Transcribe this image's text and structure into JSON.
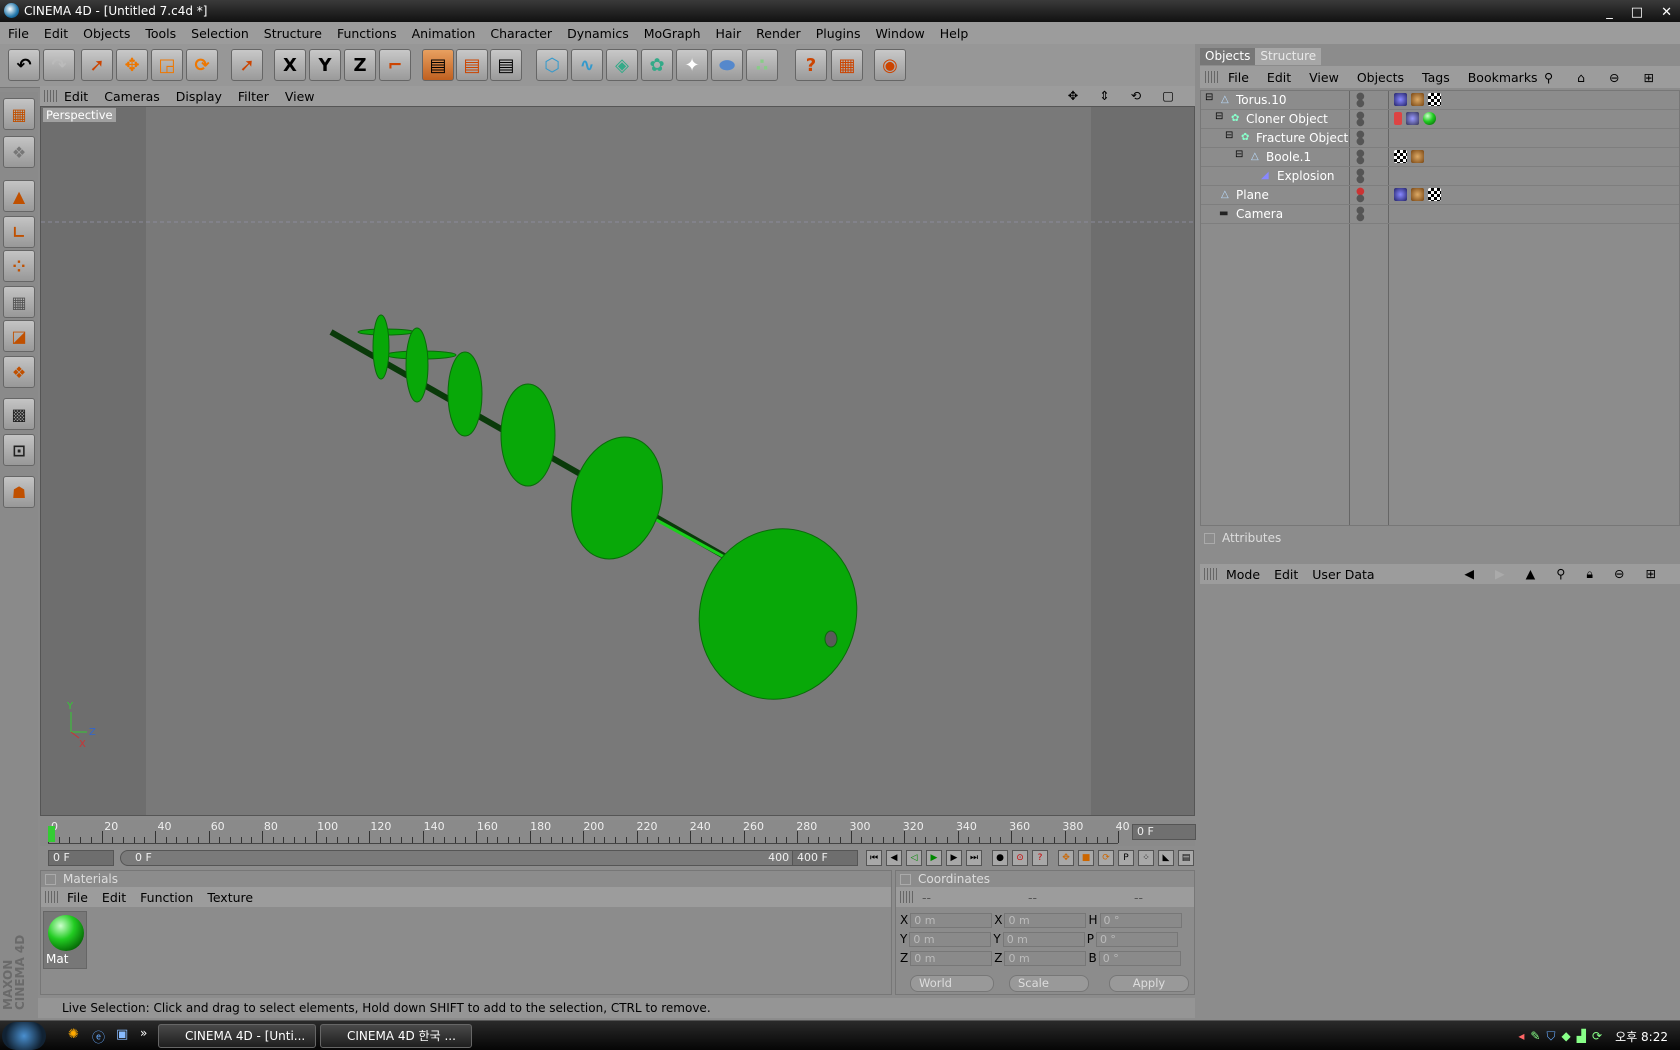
{
  "window": {
    "title": "CINEMA 4D - [Untitled 7.c4d *]",
    "controls": [
      "_",
      "□",
      "✕"
    ]
  },
  "menu": [
    "File",
    "Edit",
    "Objects",
    "Tools",
    "Selection",
    "Structure",
    "Functions",
    "Animation",
    "Character",
    "Dynamics",
    "MoGraph",
    "Hair",
    "Render",
    "Plugins",
    "Window",
    "Help"
  ],
  "toolbar": {
    "axis_x": "X",
    "axis_y": "Y",
    "axis_z": "Z"
  },
  "viewport": {
    "menu": [
      "Edit",
      "Cameras",
      "Display",
      "Filter",
      "View"
    ],
    "label": "Perspective",
    "axis": {
      "y": "Y",
      "x": "X",
      "z": "Z"
    },
    "model_color": "#08a808"
  },
  "timeline": {
    "ticks": [
      "0",
      "20",
      "40",
      "60",
      "80",
      "100",
      "120",
      "140",
      "160",
      "180",
      "200",
      "220",
      "240",
      "260",
      "280",
      "300",
      "320",
      "340",
      "360",
      "380",
      "40"
    ],
    "current_frame": "0 F",
    "start_field": "0 F",
    "range_start": "0 F",
    "range_end": "400 F",
    "end_field": "400 F"
  },
  "materials": {
    "title": "Materials",
    "menu": [
      "File",
      "Edit",
      "Function",
      "Texture"
    ],
    "items": [
      {
        "name": "Mat",
        "color": "#1fbf1f"
      }
    ]
  },
  "coordinates": {
    "title": "Coordinates",
    "headers": [
      "--",
      "--",
      "--"
    ],
    "rows": [
      {
        "a": "X",
        "av": "0 m",
        "b": "X",
        "bv": "0 m",
        "c": "H",
        "cv": "0 °"
      },
      {
        "a": "Y",
        "av": "0 m",
        "b": "Y",
        "bv": "0 m",
        "c": "P",
        "cv": "0 °"
      },
      {
        "a": "Z",
        "av": "0 m",
        "b": "Z",
        "bv": "0 m",
        "c": "B",
        "cv": "0 °"
      }
    ],
    "mode": "World",
    "scale": "Scale",
    "apply": "Apply"
  },
  "status": "Live Selection: Click and drag to select elements, Hold down SHIFT to add to the selection, CTRL to remove.",
  "brand": "MAXON CINEMA 4D",
  "objects_panel": {
    "tabs": [
      "Objects",
      "Structure"
    ],
    "menu": [
      "File",
      "Edit",
      "View",
      "Objects",
      "Tags",
      "Bookmarks"
    ],
    "items": [
      {
        "name": "Torus.10",
        "level": 0
      },
      {
        "name": "Cloner Object",
        "level": 1
      },
      {
        "name": "Fracture Object",
        "level": 2
      },
      {
        "name": "Boole.1",
        "level": 3
      },
      {
        "name": "Explosion",
        "level": 4
      },
      {
        "name": "Plane",
        "level": 0
      },
      {
        "name": "Camera",
        "level": 0
      }
    ]
  },
  "attributes": {
    "title": "Attributes",
    "menu": [
      "Mode",
      "Edit",
      "User Data"
    ]
  },
  "taskbar": {
    "tasks": [
      "CINEMA 4D - [Unti...",
      "CINEMA 4D 한국 ..."
    ],
    "clock": "오후 8:22"
  }
}
